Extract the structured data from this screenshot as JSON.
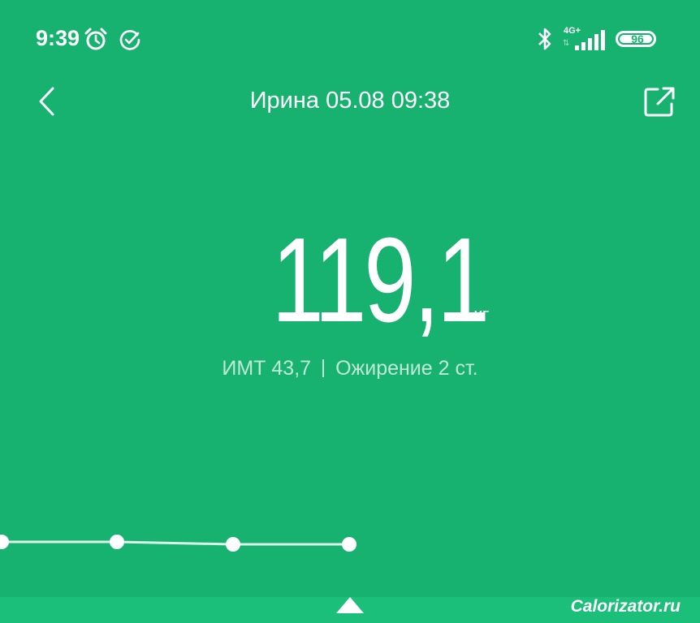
{
  "status_bar": {
    "time": "9:39",
    "network": "4G+",
    "battery": "96",
    "icons": [
      "alarm-clock-icon",
      "check-circle-icon",
      "bluetooth-icon",
      "signal-icon",
      "battery-icon"
    ]
  },
  "header": {
    "title": "Ирина 05.08 09:38",
    "back_icon": "chevron-left-icon",
    "share_icon": "share-icon"
  },
  "measurement": {
    "weight": "119,1",
    "unit": "кг",
    "bmi_label": "ИМТ 43,7",
    "category": "Ожирение 2 ст."
  },
  "trend": {
    "points": 4,
    "selected_index": 3
  },
  "watermark": "Calorizator.ru",
  "colors": {
    "background": "#17b26f",
    "text": "#ffffff"
  }
}
